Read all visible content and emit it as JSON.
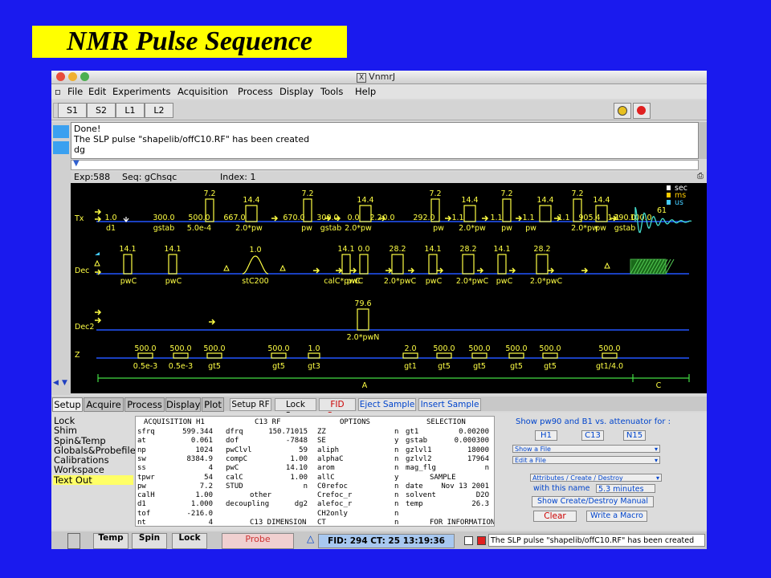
{
  "slide_title": "NMR Pulse Sequence",
  "window": {
    "title": "VnmrJ"
  },
  "menu": [
    "File",
    "Edit",
    "Experiments",
    "Acquisition",
    "Process",
    "Display",
    "Tools",
    "Help"
  ],
  "toolbar": [
    "S1",
    "S2",
    "L1",
    "L2"
  ],
  "text_output": [
    "Done!",
    "The SLP pulse \"shapelib/offC10.RF\" has been created",
    "dg"
  ],
  "exp_bar": {
    "exp": "Exp:588",
    "seq": "Seq: gChsqc",
    "index": "Index: 1"
  },
  "legend": [
    "sec",
    "ms",
    "us"
  ],
  "channels": [
    "Tx",
    "Dec",
    "Dec2",
    "Z"
  ],
  "tx": {
    "lower": [
      "1.0",
      "d1",
      "300.0",
      "gstab",
      "500.0",
      "5.0e-4",
      "667.0",
      "2.0*pw",
      "670.0",
      "pw",
      "300.0",
      "gstab",
      "0.0",
      "2.0*pw",
      "2.2",
      "0.0",
      "292.0",
      "pw",
      "1.1",
      "2.0*pw",
      "1.1",
      "pw",
      "1.1",
      "pw",
      "1.1",
      "2.0*pw",
      "905.4",
      "pw",
      "1.1",
      "390.0",
      "gstab",
      "100.0",
      "61"
    ],
    "upper": [
      "7.2",
      "14.4",
      "7.2",
      "14.4",
      "7.2",
      "14.4",
      "7.2",
      "14.4",
      "7.2",
      "14.4"
    ]
  },
  "dec": {
    "upper": [
      "14.1",
      "14.1",
      "1.0",
      "14.1",
      "0.0",
      "28.2",
      "14.1",
      "28.2",
      "14.1",
      "28.2"
    ],
    "lower": [
      "pwC",
      "pwC",
      "stC200",
      "calC*pwC",
      "pwC",
      "2.0*pwC",
      "pwC",
      "2.0*pwC",
      "pwC",
      "2.0*pwC"
    ]
  },
  "dec2": {
    "upper": "79.6",
    "lower": "2.0*pwN"
  },
  "z": {
    "upper": [
      "500.0",
      "500.0",
      "500.0",
      "500.0",
      "1.0",
      "2.0",
      "500.0",
      "500.0",
      "500.0",
      "500.0",
      "500.0"
    ],
    "lower": [
      "0.5e-3",
      "0.5e-3",
      "gt5",
      "gt5",
      "gt3",
      "gt1",
      "gt5",
      "gt5",
      "gt5",
      "gt5",
      "gt1/4.0"
    ]
  },
  "markers": [
    "A",
    "C"
  ],
  "tabs": [
    "Setup",
    "Acquire",
    "Process",
    "Display",
    "Plot"
  ],
  "action_buttons": [
    "Setup RF",
    "Lock Scan",
    "FID Scan",
    "Eject Sample",
    "Insert Sample"
  ],
  "left_list": [
    "Lock",
    "Shim",
    "Spin&Temp",
    "Globals&Probefile",
    "Calibrations",
    "Workspace",
    "Text Out"
  ],
  "param_headers": [
    "ACQUISITION H1",
    "C13 RF",
    "OPTIONS",
    "SELECTION"
  ],
  "acq": [
    [
      "sfrq",
      "599.344"
    ],
    [
      "at",
      "0.061"
    ],
    [
      "np",
      "1024"
    ],
    [
      "sw",
      "8384.9"
    ],
    [
      "ss",
      "4"
    ],
    [
      "tpwr",
      "54"
    ],
    [
      "pw",
      "7.2"
    ],
    [
      "calH",
      "1.00"
    ],
    [
      "d1",
      "1.000"
    ],
    [
      "tof",
      "-216.0"
    ],
    [
      "nt",
      "4"
    ]
  ],
  "c13": [
    [
      "dfrq",
      "150.71015"
    ],
    [
      "dof",
      "-7848"
    ],
    [
      "pwClvl",
      "59"
    ],
    [
      "compC",
      "1.00"
    ],
    [
      "pwC",
      "14.10"
    ],
    [
      "calC",
      "1.00"
    ],
    [
      "STUD",
      "n"
    ],
    [
      "other",
      ""
    ],
    [
      "decoupling",
      "dg2"
    ],
    [
      "",
      ""
    ],
    [
      "C13 DIMENSION",
      ""
    ]
  ],
  "options": [
    [
      "ZZ",
      "n"
    ],
    [
      "SE",
      "y"
    ],
    [
      "aliph",
      "n"
    ],
    [
      "alphaC",
      "n"
    ],
    [
      "arom",
      "n"
    ],
    [
      "allC",
      "y"
    ],
    [
      "C0refoc",
      "n"
    ],
    [
      "Crefoc_r",
      "n"
    ],
    [
      "alefoc_r",
      "n"
    ],
    [
      "CH2only",
      "n"
    ],
    [
      "CT",
      "n"
    ]
  ],
  "selection": [
    [
      "gt1",
      "0.00200"
    ],
    [
      "gstab",
      "0.000300"
    ],
    [
      "gzlvl1",
      "18000"
    ],
    [
      "gzlvl2",
      "17964"
    ],
    [
      "mag_flg",
      "n"
    ],
    [
      "SAMPLE",
      ""
    ],
    [
      "date",
      "Nov 13 2001"
    ],
    [
      "solvent",
      "D2O"
    ],
    [
      "temp",
      "26.3"
    ],
    [
      "",
      ""
    ],
    [
      "FOR INFORMATION",
      ""
    ]
  ],
  "right_panel": {
    "show_label": "Show pw90 and B1 vs. attenuator for :",
    "nuclei": [
      "H1",
      "C13",
      "N15"
    ],
    "dropdowns": [
      "Show a File",
      "Edit a File",
      "Attributes / Create / Destroy"
    ],
    "with_name_label": "with this name",
    "name_value": "5.3 minutes",
    "show_manual": "Show Create/Destroy Manual",
    "clear": "Clear",
    "write_macro": "Write a Macro"
  },
  "status": {
    "temp": "Temp",
    "spin": "Spin",
    "lock": "Lock",
    "probe": "Probe",
    "fid": "FID: 294 CT: 25  13:19:36",
    "message": "The SLP pulse \"shapelib/offC10.RF\" has been created"
  },
  "colors": {
    "bg": "#1a1aee",
    "title_bg": "#ffff00",
    "pulse": "#ffff44",
    "axis": "#2255ff",
    "fid_scan": "#cc0000"
  }
}
